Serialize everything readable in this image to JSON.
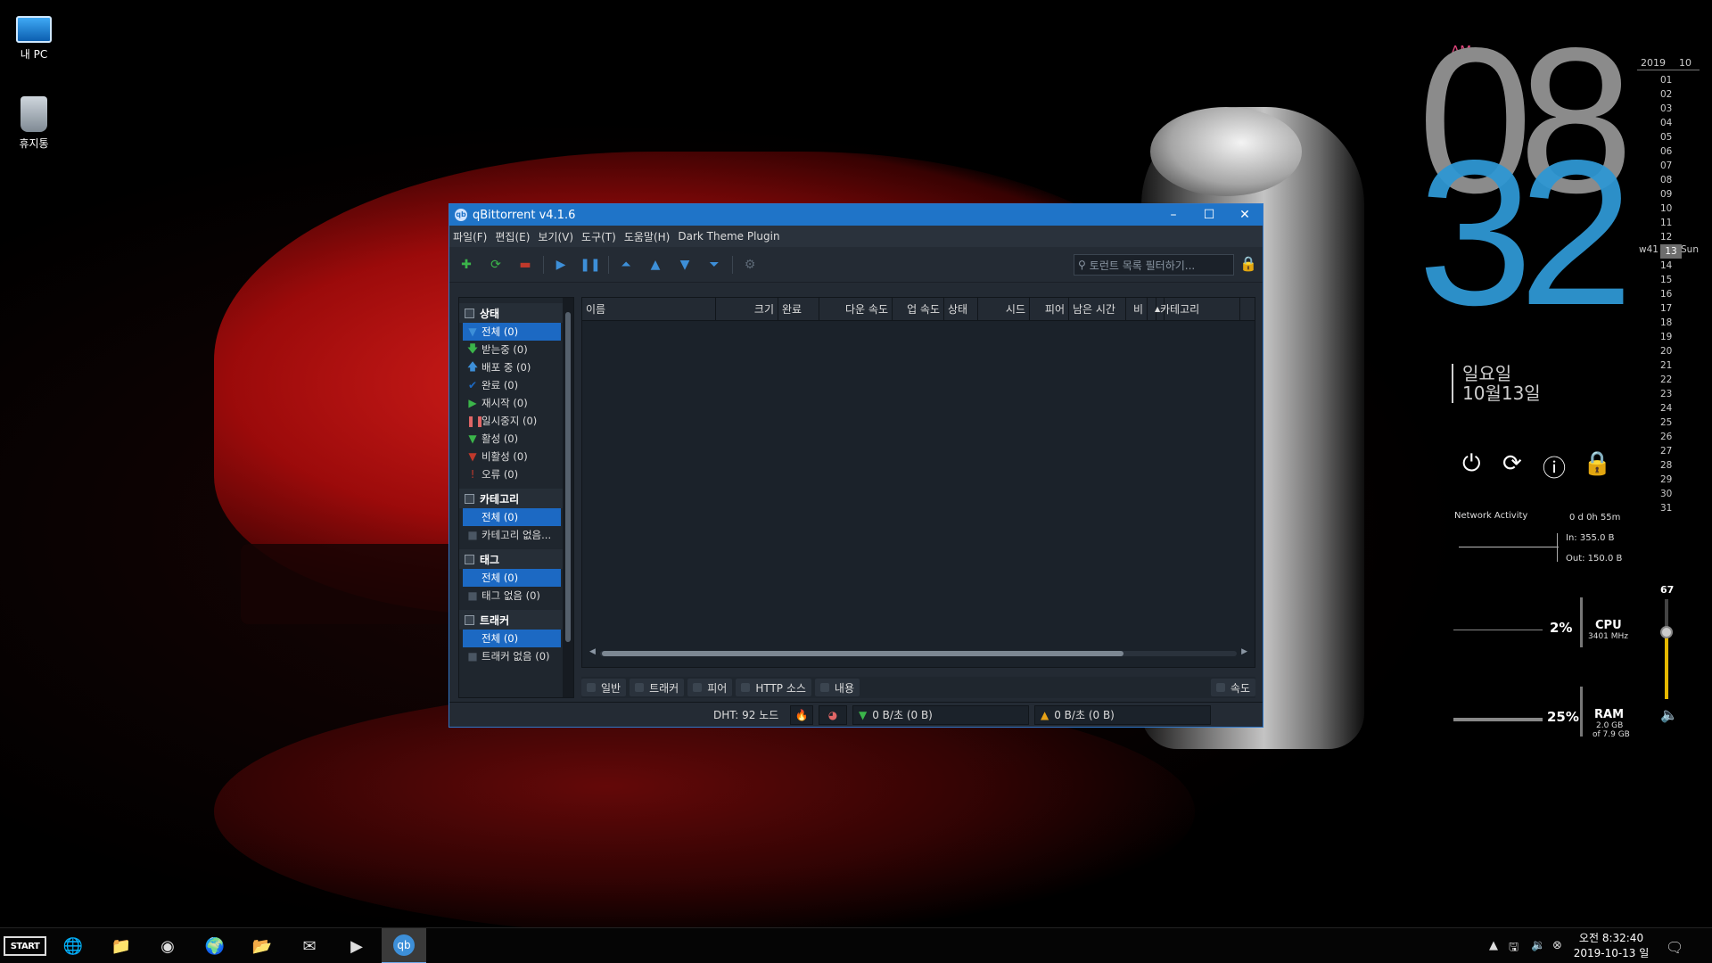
{
  "desktop": {
    "icons": [
      {
        "label": "내 PC",
        "icon": "computer-icon"
      },
      {
        "label": "휴지통",
        "icon": "recycle-bin-icon"
      }
    ]
  },
  "window": {
    "title": "qBittorrent v4.1.6",
    "menu": [
      "파일(F)",
      "편집(E)",
      "보기(V)",
      "도구(T)",
      "도움말(H)",
      "Dark Theme Plugin"
    ],
    "search_placeholder": "토런트 목록 필터하기...",
    "sidebar": {
      "status_title": "상태",
      "status_items": [
        {
          "label": "전체 (0)",
          "icon": "funnel-icon",
          "color": "#3d8fd8"
        },
        {
          "label": "받는중 (0)",
          "icon": "download-arrow-icon",
          "color": "#3bb54a"
        },
        {
          "label": "배포 중 (0)",
          "icon": "upload-arrow-icon",
          "color": "#3d8fd8"
        },
        {
          "label": "완료 (0)",
          "icon": "checkmark-icon",
          "color": "#1c69c3"
        },
        {
          "label": "재시작 (0)",
          "icon": "play-icon",
          "color": "#3bb54a"
        },
        {
          "label": "일시중지 (0)",
          "icon": "pause-icon",
          "color": "#e06666"
        },
        {
          "label": "활성 (0)",
          "icon": "funnel-icon",
          "color": "#3bb54a"
        },
        {
          "label": "비활성 (0)",
          "icon": "funnel-icon",
          "color": "#c0392b"
        },
        {
          "label": "오류 (0)",
          "icon": "exclamation-icon",
          "color": "#c0392b"
        }
      ],
      "category_title": "카테고리",
      "category_items": [
        "전체 (0)",
        "카테고리 없음..."
      ],
      "tag_title": "태그",
      "tag_items": [
        "전체 (0)",
        "태그 없음 (0)"
      ],
      "tracker_title": "트래커",
      "tracker_items": [
        "전체 (0)",
        "트래커 없음 (0)"
      ]
    },
    "columns": [
      "이름",
      "크기",
      "완료",
      "다운 속도",
      "업 속도",
      "상태",
      "시드",
      "피어",
      "남은 시간",
      "비",
      "카테고리"
    ],
    "tabs": [
      "일반",
      "트래커",
      "피어",
      "HTTP 소스",
      "내용"
    ],
    "speed_tab": "속도",
    "status": {
      "dht": "DHT: 92 노드",
      "download": "0 B/초 (0 B)",
      "upload": "0 B/초 (0 B)"
    }
  },
  "clock": {
    "ampm": "AM",
    "hour": "08",
    "minute": "32",
    "weekday": "일요일",
    "date": "10월13일"
  },
  "calendar": {
    "year": "2019",
    "month": "10",
    "week": "w41",
    "dayname": "Sun",
    "today": "13",
    "days": [
      "01",
      "02",
      "03",
      "04",
      "05",
      "06",
      "07",
      "08",
      "09",
      "10",
      "11",
      "12",
      "13",
      "14",
      "15",
      "16",
      "17",
      "18",
      "19",
      "20",
      "21",
      "22",
      "23",
      "24",
      "25",
      "26",
      "27",
      "28",
      "29",
      "30",
      "31"
    ]
  },
  "system": {
    "network_title": "Network Activity",
    "uptime": "0 d 0h 55m",
    "net_in": "In: 355.0 B",
    "net_out": "Out: 150.0 B",
    "cpu_percent": "2%",
    "cpu_label": "CPU",
    "cpu_freq": "3401 MHz",
    "ram_percent": "25%",
    "ram_label": "RAM",
    "ram_used": "2.0 GB",
    "ram_total": "of 7.9 GB",
    "volume": "67"
  },
  "taskbar": {
    "start": "START",
    "time": "오전 8:32:40",
    "date": "2019-10-13 일"
  }
}
